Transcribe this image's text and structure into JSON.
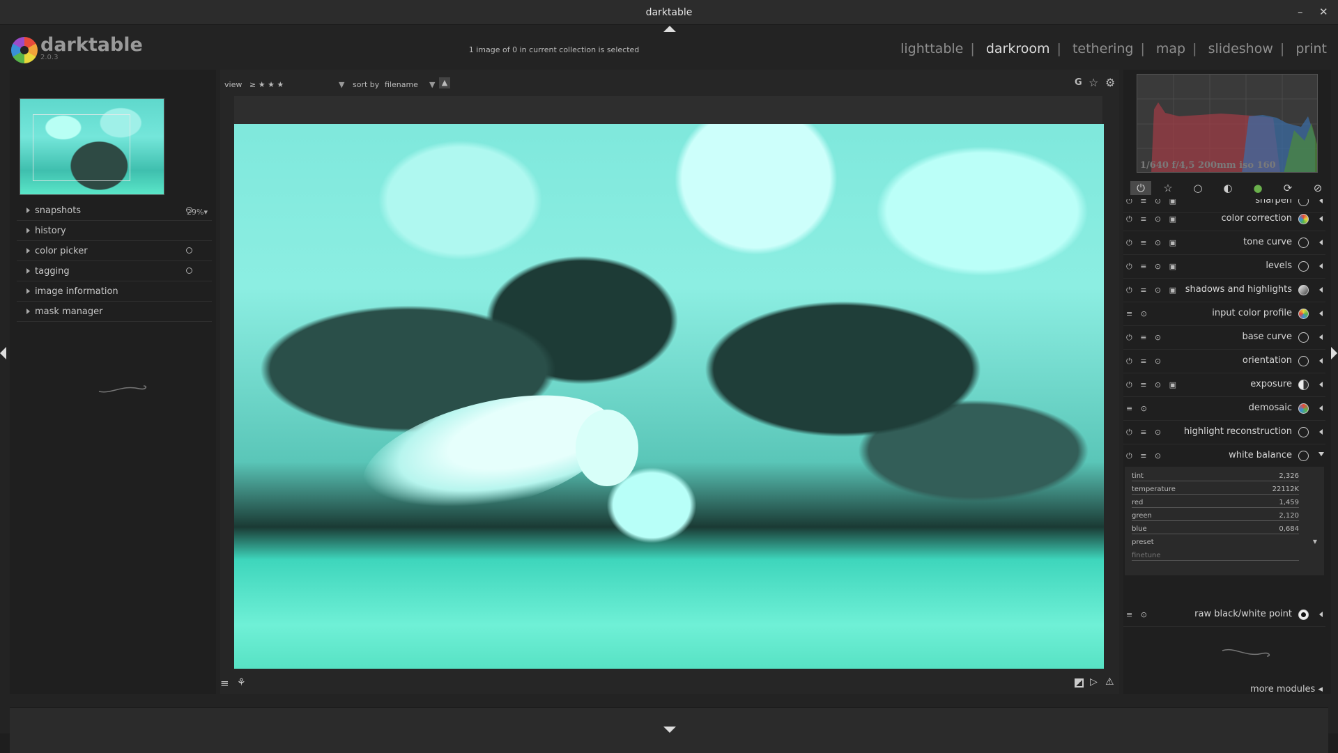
{
  "window": {
    "title": "darktable",
    "minimize": "–",
    "close": "✕"
  },
  "header": {
    "brand": "darktable",
    "version": "2.0.3",
    "collection_status": "1 image of 0 in current collection is selected",
    "views": [
      "lighttable",
      "darkroom",
      "tethering",
      "map",
      "slideshow",
      "print"
    ],
    "active_view": "darkroom",
    "separator": "|"
  },
  "left_panel": {
    "zoom": "29%▾",
    "modules": [
      {
        "label": "snapshots",
        "has_icon": true
      },
      {
        "label": "history",
        "has_icon": false
      },
      {
        "label": "color picker",
        "has_icon": true
      },
      {
        "label": "tagging",
        "has_icon": true
      },
      {
        "label": "image information",
        "has_icon": false
      },
      {
        "label": "mask manager",
        "has_icon": false
      }
    ]
  },
  "top_toolbar": {
    "view_label": "view",
    "rating_filter": "≥ ★ ★ ★",
    "sort_label": "sort by",
    "sort_value": "filename",
    "sort_dir": "▲",
    "grouping": "G",
    "star_icon": "☆",
    "gear_icon": "⚙"
  },
  "right_panel": {
    "exif": "1/640 f/4,5 200mm iso 160",
    "group_tabs": [
      "⏻",
      "☆",
      "○",
      "◐",
      "●",
      "⟳",
      "⊘"
    ],
    "modules": [
      {
        "name": "sharpen",
        "icons": "⏻ ≡ ⊙ ▣"
      },
      {
        "name": "color correction",
        "icons": "⏻ ≡ ⊙ ▣"
      },
      {
        "name": "tone curve",
        "icons": "⏻ ≡ ⊙ ▣"
      },
      {
        "name": "levels",
        "icons": "⏻ ≡ ⊙ ▣"
      },
      {
        "name": "shadows and highlights",
        "icons": "⏻ ≡ ⊙ ▣"
      },
      {
        "name": "input color profile",
        "icons": "  ≡ ⊙"
      },
      {
        "name": "base curve",
        "icons": "⏻ ≡ ⊙"
      },
      {
        "name": "orientation",
        "icons": "⏻ ≡ ⊙"
      },
      {
        "name": "exposure",
        "icons": "⏻ ≡ ⊙ ▣"
      },
      {
        "name": "demosaic",
        "icons": "  ≡ ⊙"
      },
      {
        "name": "highlight reconstruction",
        "icons": "⏻ ≡ ⊙"
      },
      {
        "name": "white balance",
        "icons": "⏻ ≡ ⊙"
      }
    ],
    "white_balance": {
      "tint_label": "tint",
      "tint": "2,326",
      "temperature_label": "temperature",
      "temperature": "22112K",
      "red_label": "red",
      "red": "1,459",
      "green_label": "green",
      "green": "2,120",
      "blue_label": "blue",
      "blue": "0,684",
      "preset_label": "preset",
      "finetune_label": "finetune"
    },
    "last_module": {
      "name": "raw black/white point",
      "icons": "  ≡ ⊙"
    },
    "more_modules": "more modules ◂"
  }
}
